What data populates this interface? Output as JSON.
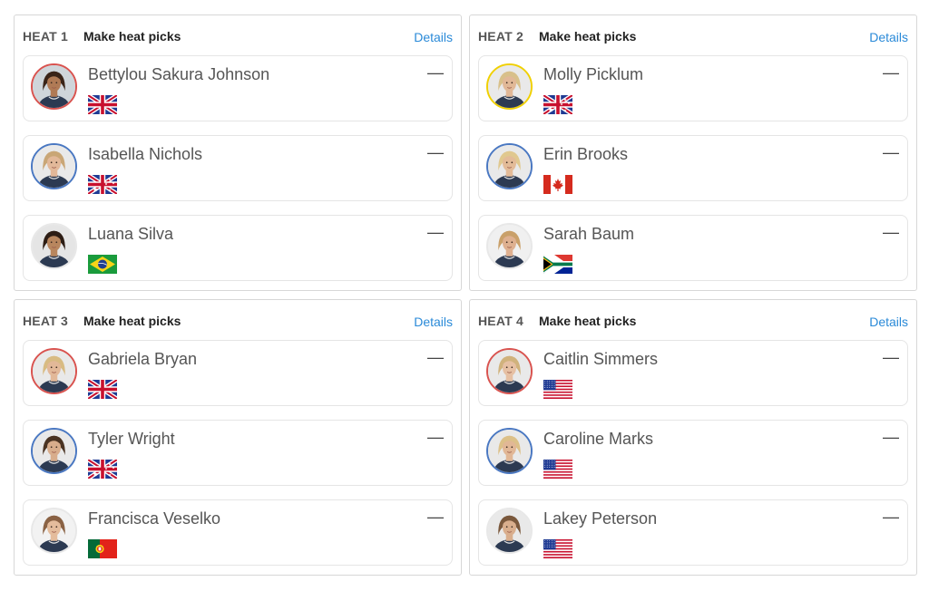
{
  "heats": [
    {
      "label": "HEAT 1",
      "action": "Make heat picks",
      "details": "Details",
      "surfers": [
        {
          "name": "Bettylou Sakura Johnson",
          "flag": "hawaii",
          "ring": "#d9534f",
          "skin": "#b07a55",
          "hair": "#3a2418",
          "bg": "#cfd5da",
          "score": "—"
        },
        {
          "name": "Isabella Nichols",
          "flag": "australia",
          "ring": "#4a78c2",
          "skin": "#e2b899",
          "hair": "#c9a676",
          "bg": "#e9e9e9",
          "score": "—"
        },
        {
          "name": "Luana Silva",
          "flag": "brazil",
          "ring": "#e8e8e8",
          "skin": "#b8865e",
          "hair": "#2d1d14",
          "bg": "#e5e5e5",
          "score": "—"
        }
      ]
    },
    {
      "label": "HEAT 2",
      "action": "Make heat picks",
      "details": "Details",
      "surfers": [
        {
          "name": "Molly Picklum",
          "flag": "australia",
          "ring": "#f0d000",
          "skin": "#e1b897",
          "hair": "#d8c08a",
          "bg": "#e9e9e9",
          "score": "—"
        },
        {
          "name": "Erin Brooks",
          "flag": "canada",
          "ring": "#4a78c2",
          "skin": "#e3bb98",
          "hair": "#e0c88f",
          "bg": "#e9e9e9",
          "score": "—"
        },
        {
          "name": "Sarah Baum",
          "flag": "south-africa",
          "ring": "#e8e8e8",
          "skin": "#deb090",
          "hair": "#c9a06a",
          "bg": "#f0f0f0",
          "score": "—"
        }
      ]
    },
    {
      "label": "HEAT 3",
      "action": "Make heat picks",
      "details": "Details",
      "surfers": [
        {
          "name": "Gabriela Bryan",
          "flag": "hawaii",
          "ring": "#d9534f",
          "skin": "#e2b898",
          "hair": "#d8bb82",
          "bg": "#e9e9e9",
          "score": "—"
        },
        {
          "name": "Tyler Wright",
          "flag": "australia",
          "ring": "#4a78c2",
          "skin": "#d8ad8c",
          "hair": "#4a3322",
          "bg": "#e9e9e9",
          "score": "—"
        },
        {
          "name": "Francisca Veselko",
          "flag": "portugal",
          "ring": "#e8e8e8",
          "skin": "#e4bc9c",
          "hair": "#8a6244",
          "bg": "#f2f2f2",
          "score": "—"
        }
      ]
    },
    {
      "label": "HEAT 4",
      "action": "Make heat picks",
      "details": "Details",
      "surfers": [
        {
          "name": "Caitlin Simmers",
          "flag": "usa",
          "ring": "#d9534f",
          "skin": "#e6c0a3",
          "hair": "#d0b27c",
          "bg": "#e9e9e9",
          "score": "—"
        },
        {
          "name": "Caroline Marks",
          "flag": "usa",
          "ring": "#4a78c2",
          "skin": "#e1b796",
          "hair": "#dcc088",
          "bg": "#e9e9e9",
          "score": "—"
        },
        {
          "name": "Lakey Peterson",
          "flag": "usa",
          "ring": "#e8e8e8",
          "skin": "#d9ae8d",
          "hair": "#7a583c",
          "bg": "#e9e9e9",
          "score": "—"
        }
      ]
    }
  ]
}
